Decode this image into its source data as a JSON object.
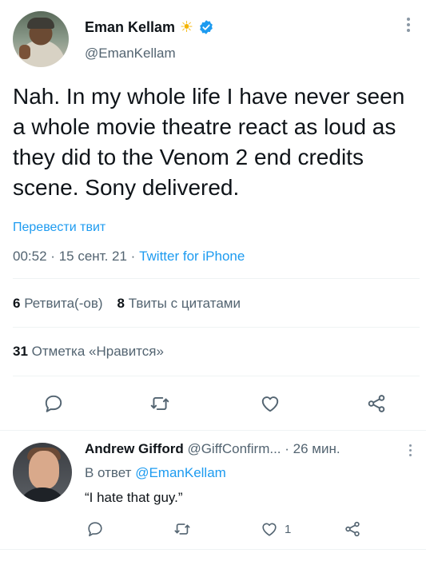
{
  "tweet": {
    "author_name": "Eman Kellam",
    "name_emoji": "☀",
    "handle": "@EmanKellam",
    "text": "Nah. In my whole life I have never seen a whole movie theatre react as loud as they did to the Venom 2 end credits scene. Sony delivered.",
    "translate_label": "Перевести твит",
    "time": "00:52",
    "date": "15 сент. 21",
    "separator": "·",
    "source": "Twitter for iPhone",
    "retweets_count": "6",
    "retweets_label": "Ретвита(-ов)",
    "quotes_count": "8",
    "quotes_label": "Твиты с цитатами",
    "likes_count": "31",
    "likes_label": "Отметка «Нравится»",
    "icons": [
      "more-icon",
      "verified-icon",
      "reply-icon",
      "retweet-icon",
      "like-icon",
      "share-icon"
    ]
  },
  "reply": {
    "author_name": "Andrew Gifford",
    "handle": "@GiffConfirm...",
    "separator": "·",
    "time_ago": "26 мин.",
    "reply_to_label": "В ответ",
    "reply_to_handle": "@EmanKellam",
    "text": "“I hate that guy.”",
    "like_count": "1"
  },
  "colors": {
    "accent": "#1d9bf0",
    "text_primary": "#0f1419",
    "text_secondary": "#536471",
    "divider": "#eff3f4",
    "icon": "#536471"
  }
}
